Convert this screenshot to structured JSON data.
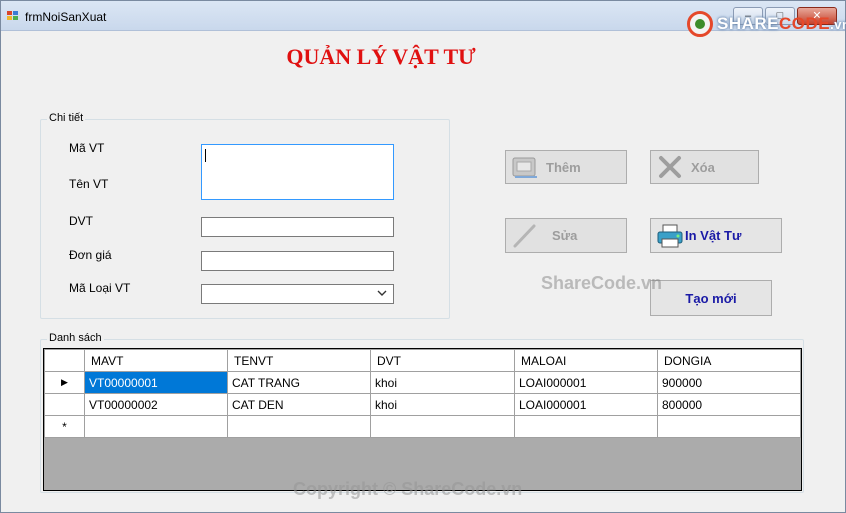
{
  "window": {
    "title": "frmNoiSanXuat",
    "buttons": {
      "minimize": "–",
      "maximize": "□",
      "close": "✕"
    }
  },
  "logo": {
    "brand_a": "SHARE",
    "brand_b": "CODE",
    "suffix": ".vn"
  },
  "heading": "QUẢN LÝ VẬT TƯ",
  "details": {
    "group_label": "Chi tiết",
    "fields": {
      "ma_vt": {
        "label": "Mã VT",
        "value": ""
      },
      "ten_vt": {
        "label": "Tên VT",
        "value": ""
      },
      "dvt": {
        "label": "DVT",
        "value": ""
      },
      "don_gia": {
        "label": "Đơn giá",
        "value": ""
      },
      "ma_loai_vt": {
        "label": "Mã Loại VT",
        "value": ""
      }
    }
  },
  "actions": {
    "them": "Thêm",
    "xoa": "Xóa",
    "sua": "Sửa",
    "in_vat_tu": "In Vật Tư",
    "tao_moi": "Tạo mới"
  },
  "list": {
    "group_label": "Danh sách",
    "columns": [
      "MAVT",
      "TENVT",
      "DVT",
      "MALOAI",
      "DONGIA"
    ],
    "rows": [
      [
        "VT00000001",
        "CAT TRANG",
        "khoi",
        "LOAI000001",
        "900000"
      ],
      [
        "VT00000002",
        "CAT DEN",
        "khoi",
        "LOAI000001",
        "800000"
      ]
    ],
    "current_row_marker": "▶",
    "new_row_marker": "*"
  },
  "watermarks": {
    "center": "ShareCode.vn",
    "footer": "Copyright © ShareCode.vn"
  },
  "colors": {
    "heading": "#e01010",
    "enabled_button_text": "#1a1aa6",
    "selection": "#0078d7"
  },
  "icons": [
    "app-icon",
    "add-icon",
    "delete-icon",
    "edit-icon",
    "printer-icon",
    "dropdown-arrow-icon"
  ]
}
